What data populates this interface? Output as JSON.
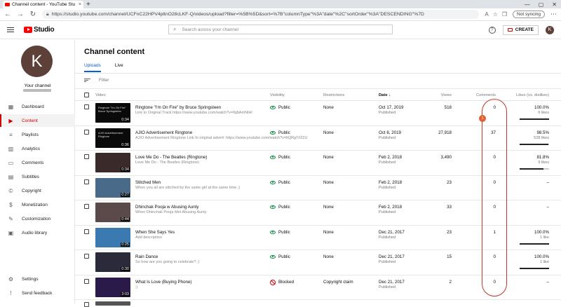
{
  "browser": {
    "tab_title": "Channel content - YouTube Stu",
    "url_scheme": "https://",
    "url": "studio.youtube.com/channel/UCFnC22HPV4pltnO28cLKF-Q/videos/upload?filter=%5B%5D&sort=%7B\"columnType\"%3A\"date\"%2C\"sortOrder\"%3A\"DESCENDING\"%7D",
    "sync_label": "Not syncing"
  },
  "header": {
    "logo_text": "Studio",
    "search_placeholder": "Search across your channel",
    "create_label": "CREATE",
    "avatar_letter": "K"
  },
  "sidebar": {
    "avatar_letter": "K",
    "channel_label": "Your channel",
    "items": [
      {
        "label": "Dashboard",
        "icon": "dashboard-icon",
        "glyph": "▦"
      },
      {
        "label": "Content",
        "icon": "content-icon",
        "glyph": "▶"
      },
      {
        "label": "Playlists",
        "icon": "playlists-icon",
        "glyph": "≡"
      },
      {
        "label": "Analytics",
        "icon": "analytics-icon",
        "glyph": "▥"
      },
      {
        "label": "Comments",
        "icon": "comments-icon",
        "glyph": "▭"
      },
      {
        "label": "Subtitles",
        "icon": "subtitles-icon",
        "glyph": "▤"
      },
      {
        "label": "Copyright",
        "icon": "copyright-icon",
        "glyph": "©"
      },
      {
        "label": "Monetization",
        "icon": "monetization-icon",
        "glyph": "$"
      },
      {
        "label": "Customization",
        "icon": "customization-icon",
        "glyph": "✎"
      },
      {
        "label": "Audio library",
        "icon": "audio-library-icon",
        "glyph": "▣"
      }
    ],
    "bottom": [
      {
        "label": "Settings",
        "icon": "settings-icon",
        "glyph": "⚙"
      },
      {
        "label": "Send feedback",
        "icon": "feedback-icon",
        "glyph": "!"
      }
    ]
  },
  "main": {
    "title": "Channel content",
    "tabs": [
      "Uploads",
      "Live"
    ],
    "filter_label": "Filter",
    "columns": {
      "video": "Video",
      "visibility": "Visibility",
      "restrictions": "Restrictions",
      "date": "Date",
      "views": "Views",
      "comments": "Comments",
      "likes": "Likes (vs. dislikes)"
    },
    "rows": [
      {
        "title": "Ringtone \"I'm On Fire\" by Bruce Springsteen",
        "desc": "Link to Original Track https://www.youtube.com/watch?v=lbjbAmNtHl",
        "visibility": "Public",
        "restrictions": "None",
        "date": "Oct 17, 2019",
        "status": "Published",
        "views": "518",
        "comments": "0",
        "likes": "100.0%",
        "likes_count": "6 likes",
        "likes_ratio": 1.0,
        "duration": "0:34",
        "thumb_caption": "Ringtone \"I'm On Fire\" Bruce Springsteen"
      },
      {
        "title": "AJIO Advertisement Ringtone",
        "desc": "AJIO Advertisement Ringtone Link fo original advert: https://www.youtube.com/watch?v=ltQRgTrl22U",
        "visibility": "Public",
        "restrictions": "None",
        "date": "Oct 8, 2019",
        "status": "Published",
        "views": "27,918",
        "comments": "37",
        "likes": "98.5%",
        "likes_count": "528 likes",
        "likes_ratio": 0.985,
        "duration": "0:36",
        "thumb_caption": "AJIO Advertisement Ringtone"
      },
      {
        "title": "Love Me Do - The Beatles (Ringtone)",
        "desc": "Love Me Do - The Beatles (Ringtone)",
        "visibility": "Public",
        "restrictions": "None",
        "date": "Feb 2, 2018",
        "status": "Published",
        "views": "3,490",
        "comments": "0",
        "likes": "81.8%",
        "likes_count": "9 likes",
        "likes_ratio": 0.818,
        "duration": "0:34",
        "thumb_caption": ""
      },
      {
        "title": "Stitched Men",
        "desc": "When you all are stitched by the same girl at the same time ;)",
        "visibility": "Public",
        "restrictions": "None",
        "date": "Feb 2, 2018",
        "status": "Published",
        "views": "23",
        "comments": "0",
        "likes": "–",
        "likes_count": "",
        "likes_ratio": null,
        "duration": "0:27",
        "thumb_caption": ""
      },
      {
        "title": "Dhinchak Pooja w Abusing Aunty",
        "desc": "When Dhinchak Pooja Met Abusing Aunty",
        "visibility": "Public",
        "restrictions": "None",
        "date": "Feb 2, 2018",
        "status": "Published",
        "views": "33",
        "comments": "0",
        "likes": "–",
        "likes_count": "",
        "likes_ratio": null,
        "duration": "0:44",
        "thumb_caption": ""
      },
      {
        "title": "When She Says Yes",
        "desc": "Add description",
        "visibility": "Public",
        "restrictions": "None",
        "date": "Dec 21, 2017",
        "status": "Published",
        "views": "23",
        "comments": "1",
        "likes": "100.0%",
        "likes_count": "1 like",
        "likes_ratio": 1.0,
        "duration": "0:25",
        "thumb_caption": ""
      },
      {
        "title": "Rain Dance",
        "desc": "So how are you going to celebrate? ;)",
        "visibility": "Public",
        "restrictions": "None",
        "date": "Dec 21, 2017",
        "status": "Published",
        "views": "15",
        "comments": "0",
        "likes": "100.0%",
        "likes_count": "1 like",
        "likes_ratio": 1.0,
        "duration": "0:30",
        "thumb_caption": ""
      },
      {
        "title": "What Is Love (Buying Phone)",
        "desc": ";)",
        "visibility": "Blocked",
        "restrictions": "Copyright claim",
        "date": "Dec 21, 2017",
        "status": "Published",
        "views": "2",
        "comments": "0",
        "likes": "–",
        "likes_count": "",
        "likes_ratio": null,
        "duration": "3:03",
        "thumb_caption": ""
      }
    ]
  },
  "annotation": {
    "badge": "1",
    "color": "#c0392b"
  },
  "colors": {
    "accent": "#065fd4",
    "brand": "#ff0000",
    "active": "#cc0000",
    "public": "#0b8a3e",
    "blocked": "#cc0000"
  }
}
